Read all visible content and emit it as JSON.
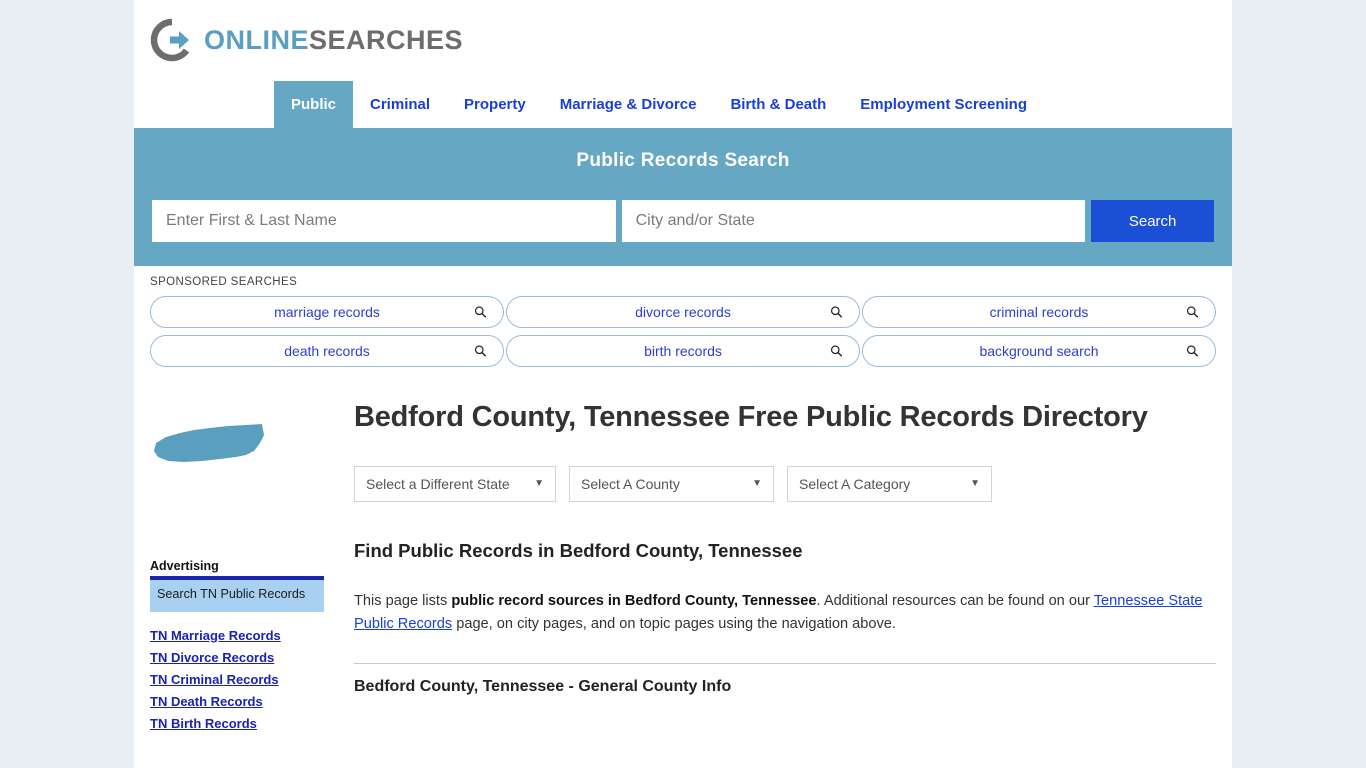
{
  "brand": {
    "part1": "ONLINE",
    "part2": "SEARCHES",
    "logo_icon": "circle-arrow-logo"
  },
  "nav": {
    "items": [
      {
        "label": "Public",
        "active": true
      },
      {
        "label": "Criminal",
        "active": false
      },
      {
        "label": "Property",
        "active": false
      },
      {
        "label": "Marriage & Divorce",
        "active": false
      },
      {
        "label": "Birth & Death",
        "active": false
      },
      {
        "label": "Employment Screening",
        "active": false
      }
    ]
  },
  "search": {
    "title": "Public Records Search",
    "name_placeholder": "Enter First & Last Name",
    "name_value": "",
    "location_placeholder": "City and/or State",
    "location_value": "",
    "button_label": "Search",
    "band_color": "#66a8c4",
    "button_color": "#1a4fd6"
  },
  "sponsored": {
    "label": "SPONSORED SEARCHES",
    "pills": [
      "marriage records",
      "divorce records",
      "criminal records",
      "death records",
      "birth records",
      "background search"
    ]
  },
  "main": {
    "state_icon": "tennessee-state-map",
    "heading": "Bedford County, Tennessee Free Public Records Directory",
    "selectors": [
      {
        "label": "Select a Different State"
      },
      {
        "label": "Select A County"
      },
      {
        "label": "Select A Category"
      }
    ],
    "subheading": "Find Public Records in Bedford County, Tennessee",
    "paragraph": {
      "part1": "This page lists ",
      "bold1": "public record sources in Bedford County, Tennessee",
      "part2": ". Additional resources can be found on our ",
      "link": "Tennessee State Public Records",
      "part3": " page, on city pages, and on topic pages using the navigation above."
    },
    "section_heading": "Bedford County, Tennessee - General County Info"
  },
  "sidebar": {
    "advertising_label": "Advertising",
    "ad_text": "Search TN Public Records",
    "links": [
      "TN Marriage Records",
      "TN Divorce Records",
      "TN Criminal Records",
      "TN Death Records",
      "TN Birth Records"
    ]
  }
}
